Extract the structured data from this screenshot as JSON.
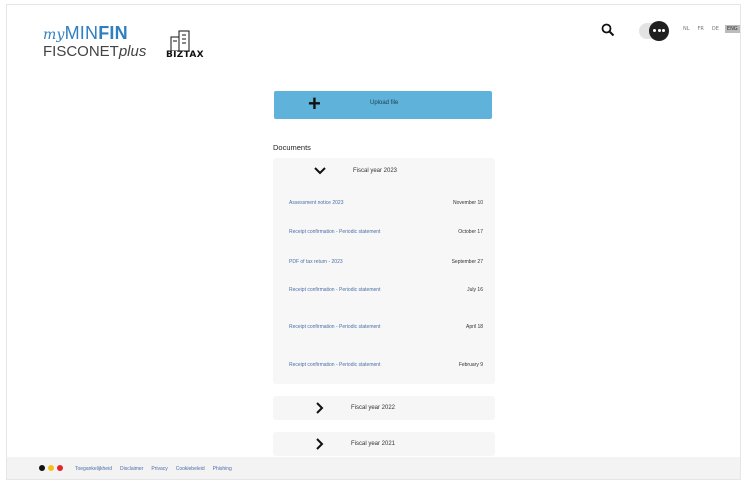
{
  "header": {
    "logo_my": "my",
    "logo_min": "MIN",
    "logo_fin": "FIN",
    "logo_fisconet": "FISCONET",
    "logo_plus": "plus",
    "logo_biztax": "BIZTAX",
    "languages": [
      {
        "code": "NL",
        "active": false
      },
      {
        "code": "FR",
        "active": false
      },
      {
        "code": "DE",
        "active": false
      },
      {
        "code": "ENG",
        "active": true
      }
    ]
  },
  "upload": {
    "label": "Upload file"
  },
  "documents": {
    "heading": "Documents",
    "sections": [
      {
        "title": "Fiscal year 2023",
        "expanded": true,
        "items": [
          {
            "name": "Assessment notice 2023",
            "date": "November 10"
          },
          {
            "name": "Receipt confirmation - Periodic statement",
            "date": "October 17"
          },
          {
            "name": "PDF of tax return - 2023",
            "date": "September 27"
          },
          {
            "name": "Receipt confirmation - Periodic statement",
            "date": "July 16"
          },
          {
            "name": "Receipt confirmation - Periodic statement",
            "date": "April 18"
          },
          {
            "name": "Receipt confirmation - Periodic statement",
            "date": "February 9"
          }
        ]
      },
      {
        "title": "Fiscal year 2022",
        "expanded": false
      },
      {
        "title": "Fiscal year 2021",
        "expanded": false
      }
    ]
  },
  "footer": {
    "flag_colors": [
      "#111111",
      "#f2c21b",
      "#e2262b"
    ],
    "links": [
      "Toegankelijkheid",
      "Disclaimer",
      "Privacy",
      "Cookiebeleid",
      "Phishing"
    ]
  },
  "colors": {
    "brand_blue": "#2f7fc1",
    "upload_button": "#5fb3db",
    "link": "#4b6fa8"
  }
}
